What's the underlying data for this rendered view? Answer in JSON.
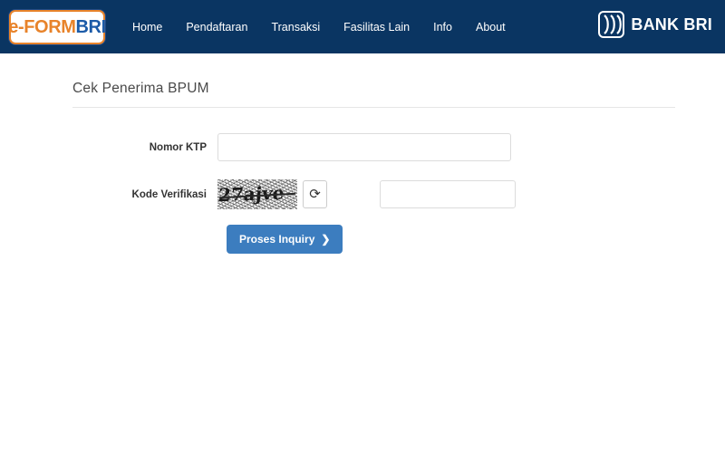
{
  "header": {
    "logo": {
      "part1": "e-FORM",
      "part2": "BRI",
      "accent_orange": "#e8832a",
      "accent_blue": "#1c5ba8"
    },
    "nav_items": [
      {
        "label": "Home",
        "name": "nav-home"
      },
      {
        "label": "Pendaftaran",
        "name": "nav-pendaftaran"
      },
      {
        "label": "Transaksi",
        "name": "nav-transaksi"
      },
      {
        "label": "Fasilitas Lain",
        "name": "nav-fasilitas-lain"
      },
      {
        "label": "Info",
        "name": "nav-info"
      },
      {
        "label": "About",
        "name": "nav-about"
      }
    ],
    "bank_logo_text": "BANK BRI",
    "background_color": "#0a3562"
  },
  "main": {
    "page_title": "Cek Penerima BPUM",
    "form": {
      "ktp": {
        "label": "Nomor KTP",
        "value": "",
        "placeholder": ""
      },
      "captcha": {
        "label": "Kode Verifikasi",
        "image_text": "27ajve",
        "refresh_icon": "refresh-icon",
        "refresh_glyph": "⟳",
        "value": "",
        "placeholder": ""
      },
      "submit": {
        "label": "Proses Inquiry",
        "chevron": "❯",
        "color": "#3c7dbf"
      }
    }
  }
}
